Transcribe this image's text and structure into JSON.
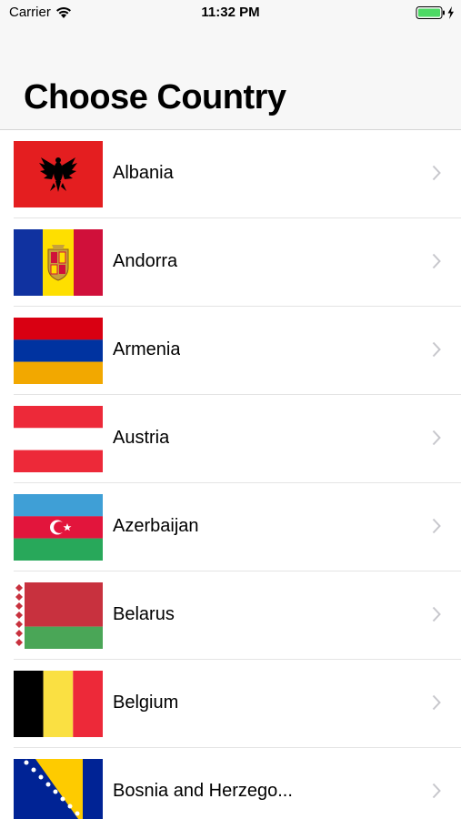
{
  "status_bar": {
    "carrier": "Carrier",
    "time": "11:32 PM",
    "icons": [
      "wifi-icon",
      "battery-icon",
      "charging-bolt-icon"
    ],
    "battery_color": "#4cd964"
  },
  "nav": {
    "title": "Choose Country"
  },
  "countries": [
    {
      "name": "Albania",
      "flag": "albania-flag-icon"
    },
    {
      "name": "Andorra",
      "flag": "andorra-flag-icon"
    },
    {
      "name": "Armenia",
      "flag": "armenia-flag-icon"
    },
    {
      "name": "Austria",
      "flag": "austria-flag-icon"
    },
    {
      "name": "Azerbaijan",
      "flag": "azerbaijan-flag-icon"
    },
    {
      "name": "Belarus",
      "flag": "belarus-flag-icon"
    },
    {
      "name": "Belgium",
      "flag": "belgium-flag-icon"
    },
    {
      "name": "Bosnia and Herzego...",
      "flag": "bosnia-flag-icon"
    }
  ],
  "row_accessory_icon": "chevron-right-icon"
}
